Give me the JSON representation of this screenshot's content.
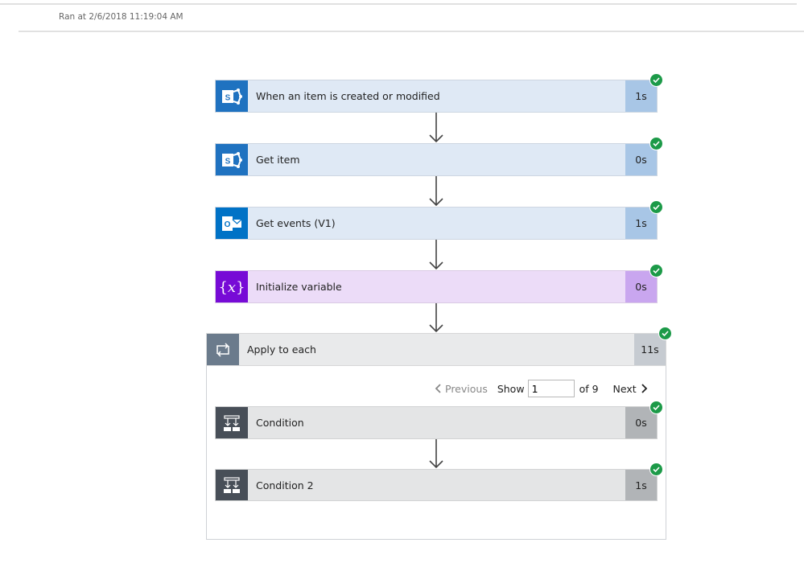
{
  "header": {
    "ran_at": "Ran at 2/6/2018 11:19:04 AM"
  },
  "steps": [
    {
      "title": "When an item is created or modified",
      "duration": "1s",
      "icon": "sharepoint-icon",
      "status": "succeeded"
    },
    {
      "title": "Get item",
      "duration": "0s",
      "icon": "sharepoint-icon",
      "status": "succeeded"
    },
    {
      "title": "Get events (V1)",
      "duration": "1s",
      "icon": "outlook-icon",
      "status": "succeeded"
    },
    {
      "title": "Initialize variable",
      "duration": "0s",
      "icon": "variable-icon",
      "status": "succeeded"
    }
  ],
  "apply_to_each": {
    "title": "Apply to each",
    "duration": "11s",
    "icon": "loop-icon",
    "status": "succeeded",
    "pager": {
      "previous": "Previous",
      "show": "Show",
      "current": "1",
      "of": "of 9",
      "next": "Next"
    },
    "steps": [
      {
        "title": "Condition",
        "duration": "0s",
        "icon": "condition-icon",
        "status": "succeeded"
      },
      {
        "title": "Condition 2",
        "duration": "1s",
        "icon": "condition-icon",
        "status": "succeeded"
      }
    ]
  },
  "colors": {
    "sharepoint": "#1f72c0",
    "outlook": "#0072c6",
    "variable": "#770bd6",
    "loop": "#6b7b8c",
    "condition": "#484f58",
    "success": "#1c9a48"
  }
}
